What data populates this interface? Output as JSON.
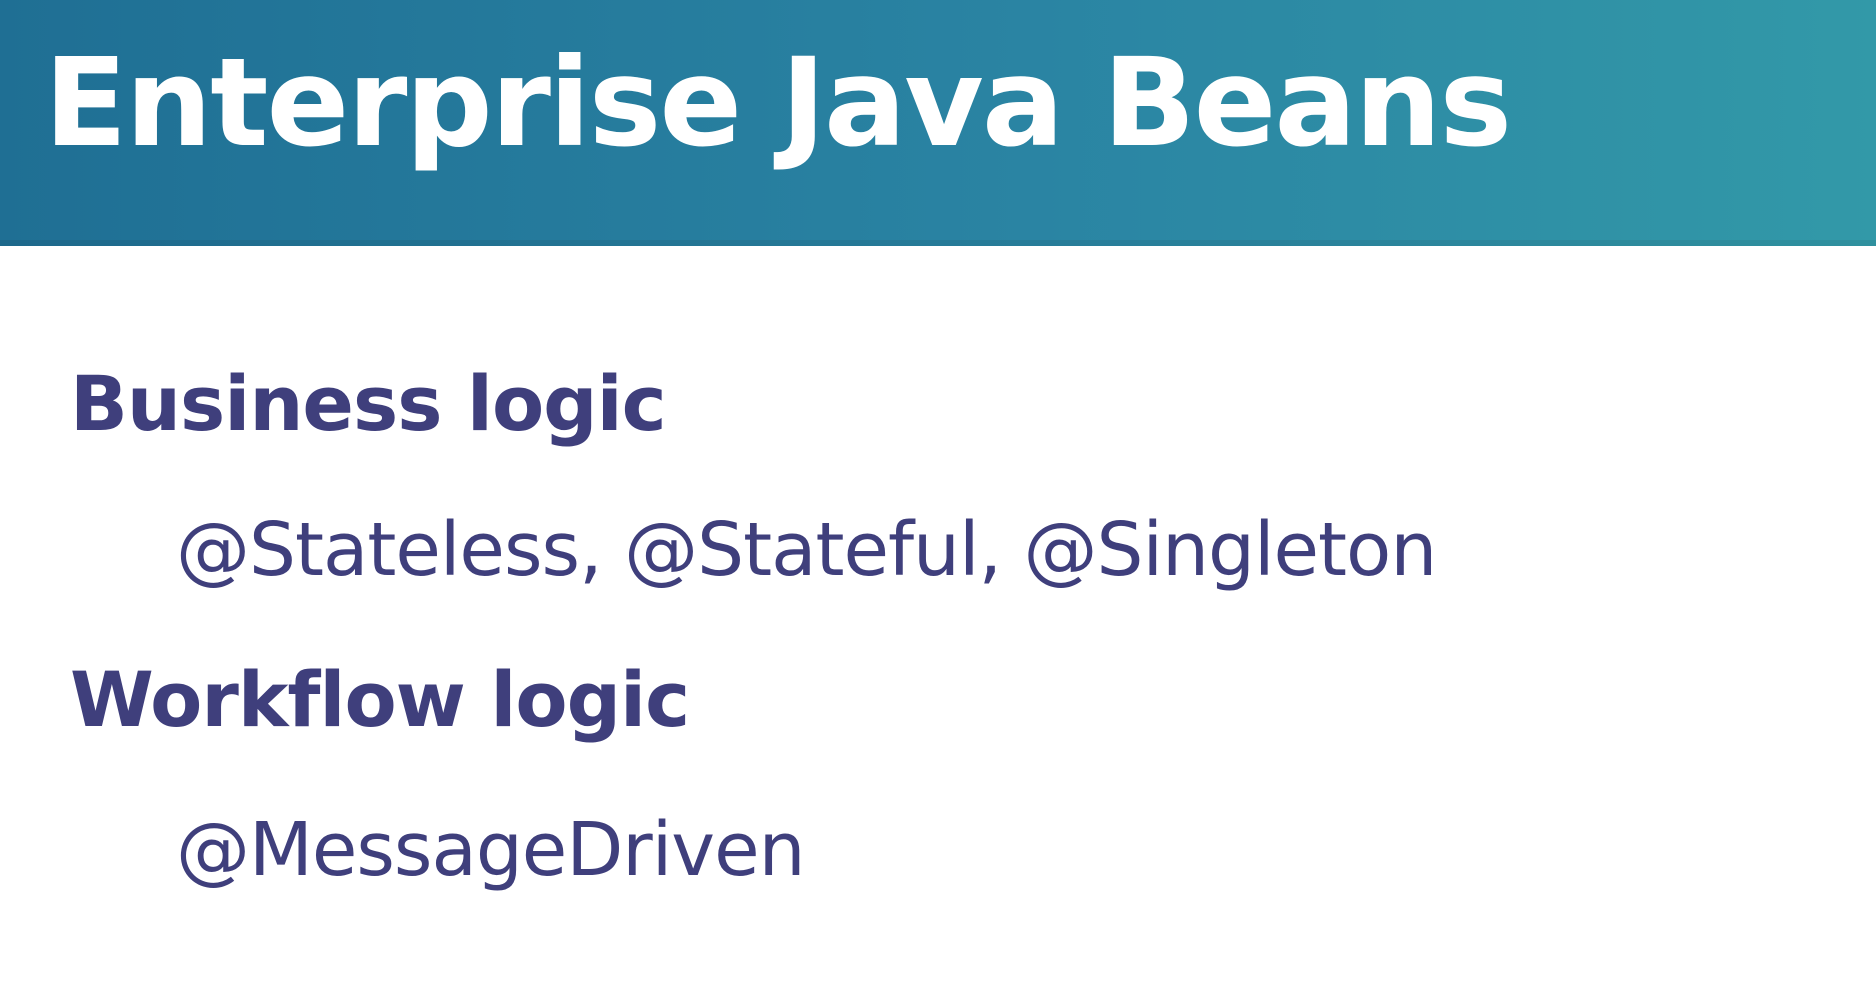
{
  "slide": {
    "title": "Enterprise Java Beans",
    "sections": [
      {
        "heading": "Business logic",
        "item": "@Stateless, @Stateful, @Singleton"
      },
      {
        "heading": "Workflow logic",
        "item": "@MessageDriven"
      }
    ]
  },
  "colors": {
    "title_bar_start": "#1f6f94",
    "title_bar_end": "#3299a8",
    "title_text": "#ffffff",
    "body_text": "#3f3f7c",
    "background": "#ffffff"
  }
}
